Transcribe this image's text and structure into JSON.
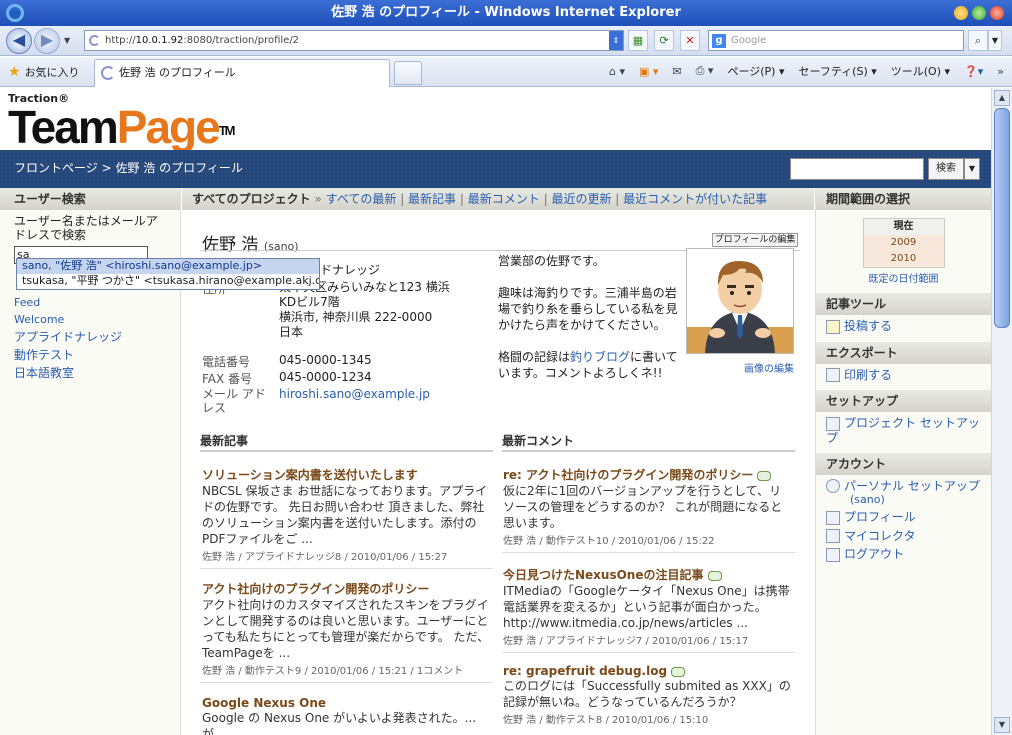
{
  "window": {
    "title": "佐野 浩 のプロフィール - Windows Internet Explorer"
  },
  "nav": {
    "url_prefix": "http://",
    "url_host": "10.0.1.92",
    "url_rest": ":8080/traction/profile/2",
    "search_placeholder": "Google"
  },
  "tabs": {
    "favorites": "お気に入り",
    "active_tab": "佐野 浩 のプロフィール",
    "cmd_page": "ページ(P)",
    "cmd_safety": "セーフティ(S)",
    "cmd_tools": "ツール(O)"
  },
  "header": {
    "brand_small": "Traction®",
    "brand_team": "Team",
    "brand_page": "Page",
    "brand_tm": "TM",
    "breadcrumb": "フロントページ > 佐野 浩 のプロフィール",
    "search_button": "検索"
  },
  "left": {
    "title": "ユーザー検索",
    "label": "ユーザー名またはメールアドレスで検索",
    "input_value": "sa",
    "autocomplete": [
      "sano, \"佐野 浩\" <hiroshi.sano@example.jp>",
      "tsukasa, \"平野 つかさ\" <tsukasa.hirano@example.akj.co.jp>"
    ],
    "links": [
      "Feed",
      "Welcome",
      "アプライドナレッジ",
      "動作テスト",
      "日本語教室"
    ]
  },
  "projbar": {
    "all": "すべてのプロジェクト",
    "links": [
      "すべての最新",
      "最新記事",
      "最新コメント",
      "最近の更新",
      "最近コメントが付いた記事"
    ]
  },
  "profile": {
    "name": "佐野 浩",
    "username": "(sano)",
    "edit_button": "プロフィールの編集",
    "project_fragment": "ドナレッジ",
    "address_label": "住所",
    "address_lines": [
      "東中央区みらいみなと123 横浜KDビル7階",
      "横浜市, 神奈川県 222-0000",
      "日本"
    ],
    "phone_label": "電話番号",
    "phone": "045-0000-1345",
    "fax_label": "FAX 番号",
    "fax": "045-0000-1234",
    "mail_label": "メール アドレス",
    "mail": "hiroshi.sano@example.jp",
    "bio1": "営業部の佐野です。",
    "bio2": "趣味は海釣りです。三浦半島の岩場で釣り糸を垂らしている私を見かけたら声をかけてください。",
    "bio3a": "格闘の記録は",
    "bio3link": "釣りブログ",
    "bio3b": "に書いています。コメントよろしくネ!!",
    "image_edit": "画像の編集"
  },
  "recent_articles": {
    "title": "最新記事",
    "items": [
      {
        "title": "ソリューション案内書を送付いたします",
        "body": "NBCSL 保坂さま お世話になっております。アプライドの佐野です。 先日お問い合わせ 頂きました、弊社のソリューション案内書を送付いたします。添付のPDFファイルをご ...",
        "meta": "佐野 浩 / アプライドナレッジ8 / 2010/01/06 / 15:27"
      },
      {
        "title": "アクト社向けのプラグイン開発のポリシー",
        "body": "アクト社向けのカスタマイズされたスキンをプラグインとして開発するのは良いと思います。ユーザーにとっても私たちにとっても管理が楽だからです。 ただ、TeamPageを ...",
        "meta": "佐野 浩 / 動作テスト9 / 2010/01/06 / 15:21 / 1コメント"
      },
      {
        "title": "Google Nexus One",
        "body": "Google の Nexus One がいよいよ発表された。...が、",
        "meta": ""
      }
    ]
  },
  "recent_comments": {
    "title": "最新コメント",
    "items": [
      {
        "title": "re: アクト社向けのプラグイン開発のポリシー",
        "body": "仮に2年に1回のバージョンアップを行うとして、リソースの管理をどうするのか？ これが問題になると思います。",
        "meta": "佐野 浩 / 動作テスト10 / 2010/01/06 / 15:22"
      },
      {
        "title": "今日見つけたNexusOneの注目記事",
        "body": "ITMediaの「Googleケータイ「Nexus One」は携帯電話業界を変えるか」という記事が面白かった。",
        "link": "http://www.itmedia.co.jp/news/articles ...",
        "meta": "佐野 浩 / アプライドナレッジ7 / 2010/01/06 / 15:17"
      },
      {
        "title": "re: grapefruit debug.log",
        "body": "このログには「Successfully submited as XXX」の記録が無いね。どうなっているんだろうか？",
        "meta": "佐野 浩 / 動作テスト8 / 2010/01/06 / 15:10"
      }
    ]
  },
  "right": {
    "range_title": "期間範囲の選択",
    "range_current": "現在",
    "range_years": [
      "2009",
      "2010"
    ],
    "range_link": "既定の日付範囲",
    "tools_title": "記事ツール",
    "post": "投稿する",
    "export_title": "エクスポート",
    "print": "印刷する",
    "setup_title": "セットアップ",
    "project_setup": "プロジェクト セットアップ",
    "account_title": "アカウント",
    "personal_setup": "パーソナル セットアップ",
    "personal_user": "(sano)",
    "profile": "プロフィール",
    "collector": "マイコレクタ",
    "logout": "ログアウト"
  },
  "colors": {
    "brand_orange": "#e8761a",
    "header_blue": "#25477a",
    "link": "#2a5db0"
  }
}
